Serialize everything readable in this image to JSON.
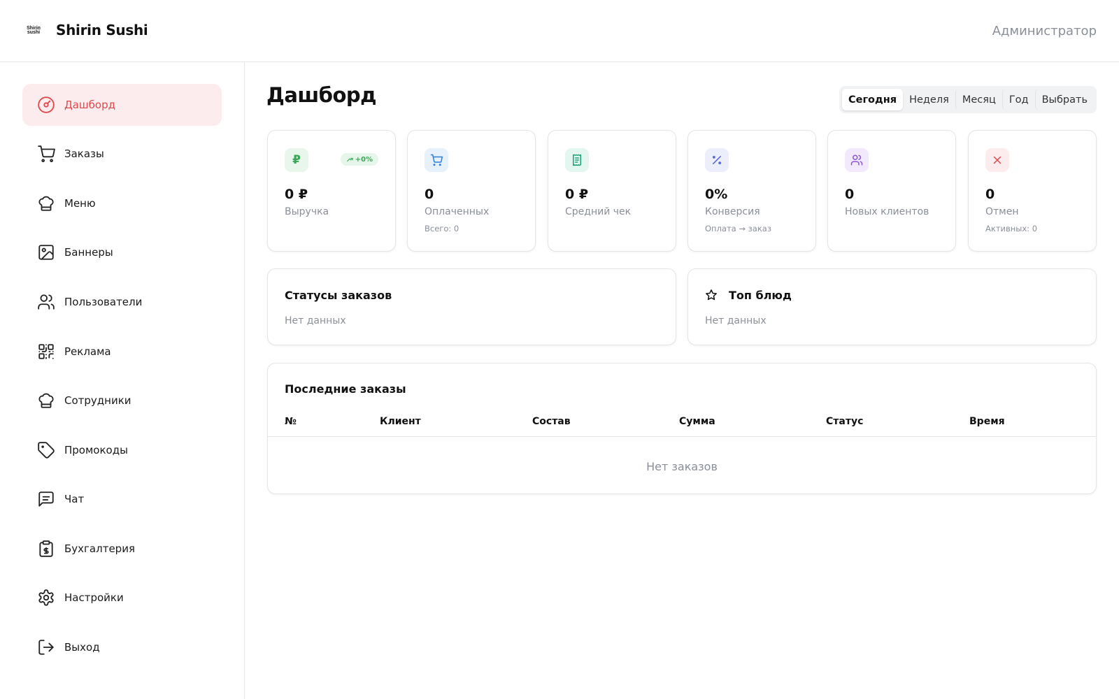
{
  "header": {
    "logo_text": "Shirin sushi",
    "brand": "Shirin Sushi",
    "role": "Администратор"
  },
  "sidebar": {
    "items": [
      {
        "label": "Дашборд",
        "icon": "gauge-icon",
        "active": true
      },
      {
        "label": "Заказы",
        "icon": "cart-icon"
      },
      {
        "label": "Меню",
        "icon": "chef-hat-icon"
      },
      {
        "label": "Баннеры",
        "icon": "image-icon"
      },
      {
        "label": "Пользователи",
        "icon": "users-icon"
      },
      {
        "label": "Реклама",
        "icon": "qr-code-icon"
      },
      {
        "label": "Сотрудники",
        "icon": "chef-hat-icon"
      },
      {
        "label": "Промокоды",
        "icon": "tag-icon"
      },
      {
        "label": "Чат",
        "icon": "chat-icon"
      },
      {
        "label": "Бухгалтерия",
        "icon": "clipboard-dollar-icon"
      },
      {
        "label": "Настройки",
        "icon": "gear-icon"
      },
      {
        "label": "Выход",
        "icon": "logout-icon"
      }
    ]
  },
  "main": {
    "title": "Дашборд",
    "period": {
      "options": [
        "Сегодня",
        "Неделя",
        "Месяц",
        "Год",
        "Выбрать"
      ],
      "selected": "Сегодня"
    },
    "stats": [
      {
        "value": "0 ₽",
        "label": "Выручка",
        "sub": "",
        "trend": "+0%",
        "icon": "ruble-icon",
        "color": "#3aa856",
        "bg": "#e8f6ec"
      },
      {
        "value": "0",
        "label": "Оплаченных",
        "sub": "Всего: 0",
        "icon": "cart-icon",
        "color": "#2f7fd8",
        "bg": "#e6f1fc"
      },
      {
        "value": "0 ₽",
        "label": "Средний чек",
        "sub": "",
        "icon": "receipt-icon",
        "color": "#21a27a",
        "bg": "#e3f6ef"
      },
      {
        "value": "0%",
        "label": "Конверсия",
        "sub": "Оплата → заказ",
        "icon": "percent-icon",
        "color": "#4f5fd6",
        "bg": "#eceefc"
      },
      {
        "value": "0",
        "label": "Новых клиентов",
        "sub": "",
        "icon": "users-icon",
        "color": "#8a55d6",
        "bg": "#f2eafc"
      },
      {
        "value": "0",
        "label": "Отмен",
        "sub": "Активных: 0",
        "icon": "x-icon",
        "color": "#e0474c",
        "bg": "#fdeced"
      }
    ],
    "order_statuses": {
      "title": "Статусы заказов",
      "empty": "Нет данных"
    },
    "top_dishes": {
      "title": "Топ блюд",
      "empty": "Нет данных",
      "icon": "star-icon"
    },
    "recent_orders": {
      "title": "Последние заказы",
      "columns": [
        "№",
        "Клиент",
        "Состав",
        "Сумма",
        "Статус",
        "Время"
      ],
      "empty": "Нет заказов"
    }
  }
}
